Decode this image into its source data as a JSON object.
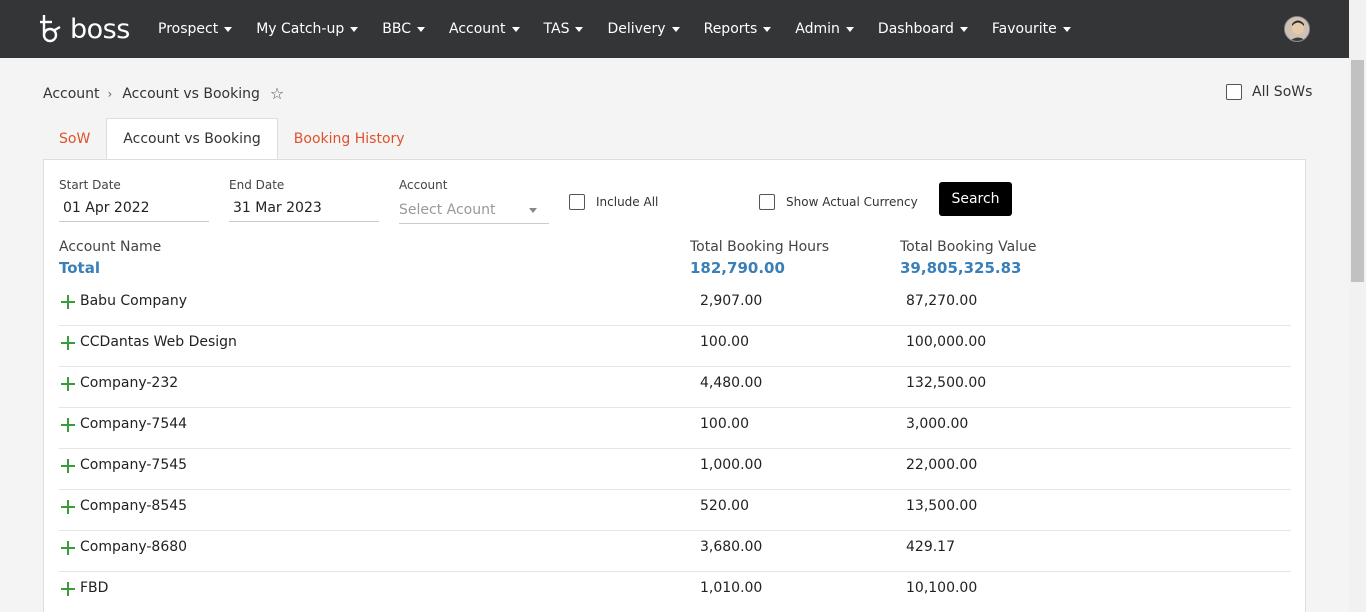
{
  "logo": {
    "text": "boss"
  },
  "nav": [
    {
      "label": "Prospect"
    },
    {
      "label": "My Catch-up"
    },
    {
      "label": "BBC"
    },
    {
      "label": "Account"
    },
    {
      "label": "TAS"
    },
    {
      "label": "Delivery"
    },
    {
      "label": "Reports"
    },
    {
      "label": "Admin"
    },
    {
      "label": "Dashboard"
    },
    {
      "label": "Favourite"
    }
  ],
  "breadcrumb": {
    "root": "Account",
    "current": "Account vs Booking",
    "separator": "›"
  },
  "all_sows": {
    "label": "All SoWs",
    "checked": false
  },
  "tabs": [
    {
      "label": "SoW",
      "active": false
    },
    {
      "label": "Account vs Booking",
      "active": true
    },
    {
      "label": "Booking History",
      "active": false
    }
  ],
  "filters": {
    "start_date_label": "Start Date",
    "start_date_value": "01 Apr 2022",
    "end_date_label": "End Date",
    "end_date_value": "31 Mar 2023",
    "account_label": "Account",
    "account_placeholder": "Select Acount",
    "include_all_label": "Include All",
    "show_actual_currency_label": "Show Actual Currency",
    "search_label": "Search"
  },
  "table": {
    "headers": {
      "name": "Account Name",
      "hours": "Total Booking Hours",
      "value": "Total Booking Value"
    },
    "total": {
      "label": "Total",
      "hours": "182,790.00",
      "value": "39,805,325.83"
    },
    "rows": [
      {
        "name": "Babu Company",
        "hours": "2,907.00",
        "value": "87,270.00"
      },
      {
        "name": "CCDantas Web Design",
        "hours": "100.00",
        "value": "100,000.00"
      },
      {
        "name": "Company-232",
        "hours": "4,480.00",
        "value": "132,500.00"
      },
      {
        "name": "Company-7544",
        "hours": "100.00",
        "value": "3,000.00"
      },
      {
        "name": "Company-7545",
        "hours": "1,000.00",
        "value": "22,000.00"
      },
      {
        "name": "Company-8545",
        "hours": "520.00",
        "value": "13,500.00"
      },
      {
        "name": "Company-8680",
        "hours": "3,680.00",
        "value": "429.17"
      },
      {
        "name": "FBD",
        "hours": "1,010.00",
        "value": "10,100.00"
      }
    ]
  },
  "colors": {
    "topbar": "#333537",
    "accent_tab": "#e0522c",
    "total": "#3a7fb8",
    "plus": "#3a9b3a"
  }
}
